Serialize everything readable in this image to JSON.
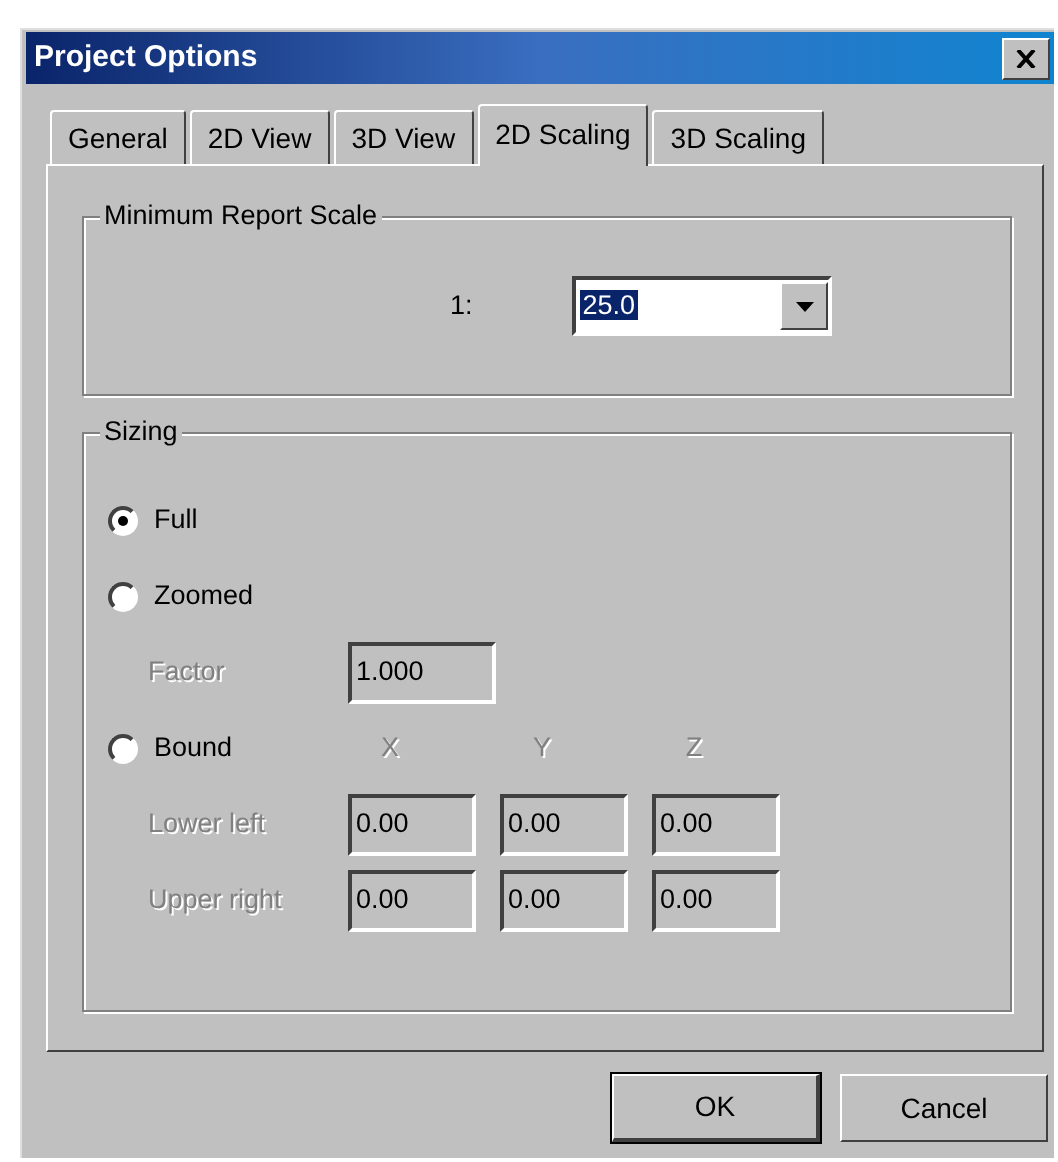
{
  "window": {
    "title": "Project Options"
  },
  "tabs": [
    {
      "label": "General",
      "selected": false
    },
    {
      "label": "2D View",
      "selected": false
    },
    {
      "label": "3D View",
      "selected": false
    },
    {
      "label": "2D Scaling",
      "selected": true
    },
    {
      "label": "3D Scaling",
      "selected": false
    }
  ],
  "scale_group": {
    "title": "Minimum Report Scale",
    "label": "1:",
    "value": "25.0",
    "value_selected": true
  },
  "sizing_group": {
    "title": "Sizing",
    "options": [
      {
        "label": "Full",
        "selected": true
      },
      {
        "label": "Zoomed",
        "selected": false
      },
      {
        "label": "Bound",
        "selected": false
      }
    ],
    "factor": {
      "label": "Factor",
      "value": "1.000",
      "disabled": true
    },
    "bound": {
      "disabled": true,
      "columns": [
        "X",
        "Y",
        "Z"
      ],
      "rows": [
        {
          "label": "Lower left",
          "values": [
            "0.00",
            "0.00",
            "0.00"
          ]
        },
        {
          "label": "Upper right",
          "values": [
            "0.00",
            "0.00",
            "0.00"
          ]
        }
      ]
    }
  },
  "buttons": [
    {
      "label": "OK",
      "default": true
    },
    {
      "label": "Cancel",
      "default": false
    }
  ]
}
